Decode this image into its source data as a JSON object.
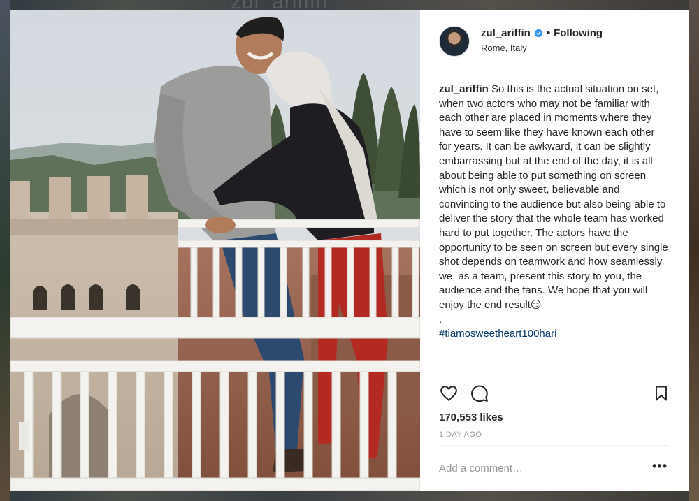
{
  "background": {
    "page_title_fragment": "zul_ariffin"
  },
  "post": {
    "username": "zul_ariffin",
    "verified": true,
    "separator": "•",
    "follow_status": "Following",
    "location": "Rome, Italy",
    "caption_username": "zul_ariffin",
    "caption_text": "So this is the actual situation on set, when two actors who may not be familiar with each other are placed in moments where they have to seem like they have known each other for years. It can be awkward, it can be slightly embarrassing but at the end of the day, it is all about being able to put something on screen which is not only sweet, believable and convincing to the audience but also being able to deliver the story that the whole team has worked hard to put together. The actors have the opportunity to be seen on screen but every single shot depends on teamwork and how seamlessly we, as a team, present this story to you, the audience and the fans. We hope that you will enjoy the end result😏",
    "caption_period": ".",
    "hashtag": "#tiamosweetheart100hari",
    "likes": "170,553 likes",
    "time_ago": "1 DAY AGO",
    "comment_placeholder": "Add a comment…",
    "more_options": "•••"
  },
  "icons": {
    "like": "heart-icon",
    "comment": "comment-bubble-icon",
    "save": "bookmark-icon",
    "verified": "verified-badge-icon"
  },
  "colors": {
    "text": "#262626",
    "muted": "#999999",
    "verified_blue": "#3897f0",
    "hashtag": "#003569",
    "divider": "#efefef"
  }
}
